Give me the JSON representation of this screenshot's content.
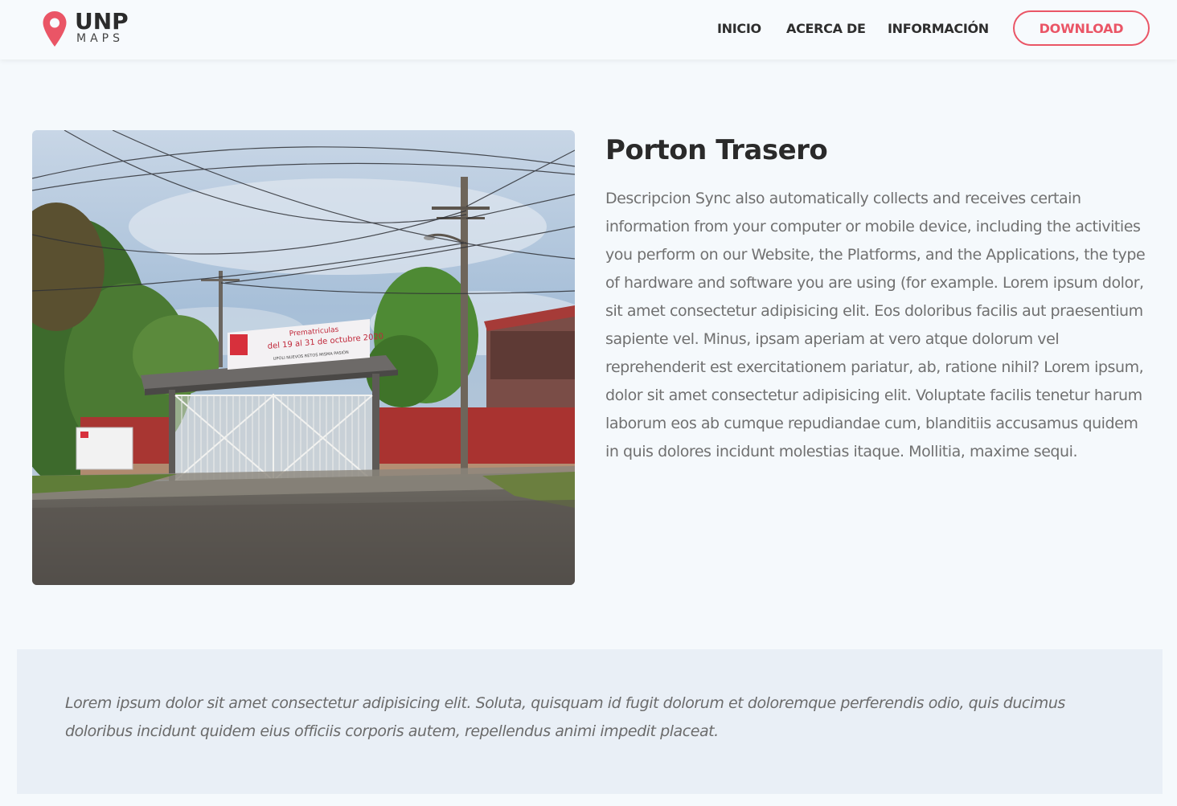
{
  "brand": {
    "name": "UNP",
    "tagline": "MAPS",
    "accent_color": "#ea5566",
    "icon": "map-pin-icon"
  },
  "nav": {
    "items": [
      {
        "label": "INICIO"
      },
      {
        "label": "ACERCA DE"
      },
      {
        "label": "INFORMACIÓN"
      }
    ],
    "download_label": "DOWNLOAD"
  },
  "place": {
    "title": "Porton Trasero",
    "description": "Descripcion Sync also automatically collects and receives certain information from your computer or mobile device, including the activities you perform on our Website, the Platforms, and the Applications, the type of hardware and software you are using (for example. Lorem ipsum dolor, sit amet consectetur adipisicing elit. Eos doloribus facilis aut praesentium sapiente vel. Minus, ipsam aperiam at vero atque dolorum vel reprehenderit est exercitationem pariatur, ab, ratione nihil? Lorem ipsum, dolor sit amet consectetur adipisicing elit. Voluptate facilis tenetur harum laborum eos ab cumque repudiandae cum, blanditiis accusamus quidem in quis dolores incidunt molestias itaque. Mollitia, maxime sequi.",
    "photo": {
      "banner_line1": "Prematriculas",
      "banner_line2": "del 19 al 31 de octubre 2020",
      "banner_line3": "UPOLI NUEVOS RETOS MISMA PASIÓN"
    }
  },
  "quote": {
    "text": "Lorem ipsum dolor sit amet consectetur adipisicing elit. Soluta, quisquam id fugit dolorum et doloremque perferendis odio, quis ducimus doloribus incidunt quidem eius officiis corporis autem, repellendus animi impedit placeat."
  }
}
